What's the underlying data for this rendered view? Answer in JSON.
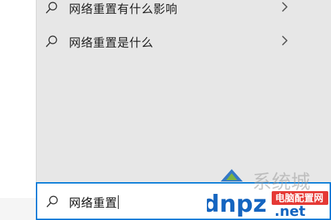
{
  "suggestions": [
    {
      "label": "网络重置有什么影响",
      "icon": "search-icon",
      "chevron": "chevron-right-icon"
    },
    {
      "label": "网络重置是什么",
      "icon": "search-icon",
      "chevron": "chevron-right-icon"
    }
  ],
  "search": {
    "value": "网络重置",
    "icon": "search-icon",
    "border_color": "#0078d7"
  },
  "watermark": {
    "logo_text": "系统城",
    "domain_text": "dnpz.net",
    "badge_text": "电脑配置网",
    "accent_blue": "#1565c0",
    "accent_red": "#e53935",
    "accent_green": "#7cb342"
  },
  "colors": {
    "panel_bg": "#e7e7e7",
    "text": "#1f1f1f"
  }
}
